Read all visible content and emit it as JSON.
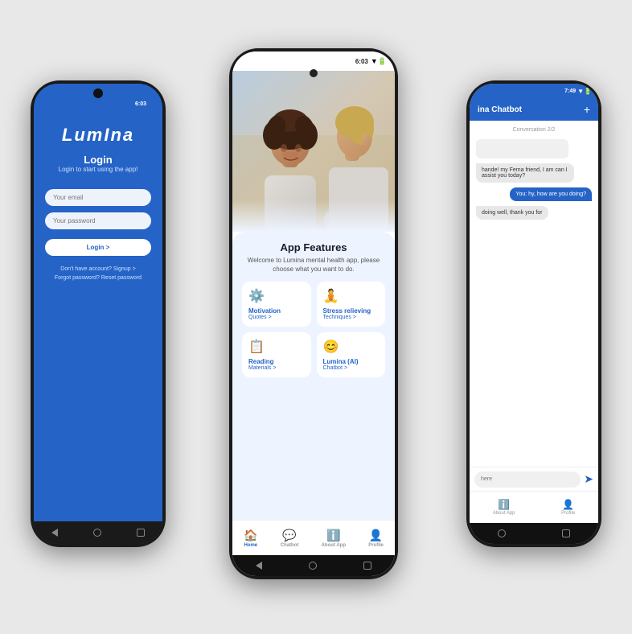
{
  "scene": {
    "bg_color": "#e0e0e0"
  },
  "left_phone": {
    "status_time": "6:03",
    "screen": {
      "logo": "LumIna",
      "title": "Login",
      "subtitle": "Login to start using the app!",
      "email_placeholder": "Your email",
      "password_placeholder": "Your password",
      "login_button": "Login >",
      "link1": "Don't have account? Signup >",
      "link2": "Forgot password? Reset password"
    }
  },
  "center_phone": {
    "status_time": "6:03",
    "screen": {
      "photo_alt": "Two women in conversation",
      "features_title": "App Features",
      "features_subtitle": "Welcome to Lumina mental health app, please choose what you want to do.",
      "grid": [
        {
          "icon": "⚙",
          "name": "Motivation",
          "action": "Quotes >"
        },
        {
          "icon": "🧘",
          "name": "Stress relieving",
          "action": "Techniques >"
        },
        {
          "icon": "📋",
          "name": "Reading",
          "action": "Materials >"
        },
        {
          "icon": "😊",
          "name": "Lumina (AI)",
          "action": "Chatbot >"
        }
      ],
      "nav": [
        {
          "icon": "🏠",
          "label": "Home",
          "active": true
        },
        {
          "icon": "💬",
          "label": "Chatbot",
          "active": false
        },
        {
          "icon": "ℹ",
          "label": "About App",
          "active": false
        },
        {
          "icon": "👤",
          "label": "Profile",
          "active": false
        }
      ]
    }
  },
  "right_phone": {
    "status_time": "7:49",
    "screen": {
      "header_title": "ina Chatbot",
      "header_plus": "+",
      "conversation_label": "Conversation 2/2",
      "bubble1": "hande!  my Fema friend, I am can I assist you today?",
      "bubble2": "You: hy, how are you doing?",
      "bubble3": "doing well, thank you for",
      "input_placeholder": "here",
      "nav": [
        {
          "icon": "ℹ",
          "label": "About App"
        },
        {
          "icon": "👤",
          "label": "Profile"
        }
      ]
    }
  }
}
